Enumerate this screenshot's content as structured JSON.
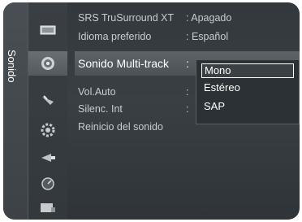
{
  "tab": {
    "label": "Sonido"
  },
  "menu": {
    "rows": [
      {
        "label": "SRS TruSurround XT",
        "value": ": Apagado"
      },
      {
        "label": "Idioma preferido",
        "value": ": Español"
      },
      {
        "label": "Sonido Multi-track",
        "value": ":"
      },
      {
        "label": "Vol.Auto",
        "value": ": "
      },
      {
        "label": "Silenc. Int",
        "value": ": "
      },
      {
        "label": "Reinicio del sonido",
        "value": ""
      }
    ],
    "active_index": 2
  },
  "popup": {
    "options": [
      "Mono",
      "Estéreo",
      "SAP"
    ],
    "selected": "Mono"
  },
  "icons": [
    "picture-icon",
    "sound-icon",
    "channel-icon",
    "setup-icon",
    "input-icon",
    "application-icon",
    "support-icon"
  ],
  "colors": {
    "panel": "#33383c",
    "highlight": "#5e6367",
    "text": "#c8ccd0",
    "active_text": "#ffffff"
  }
}
